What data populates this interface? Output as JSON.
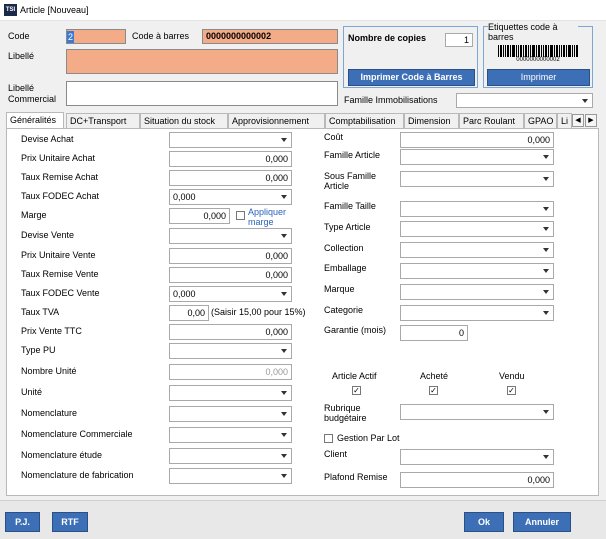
{
  "window": {
    "icon_text": "TSI",
    "title": "Article [Nouveau]"
  },
  "header": {
    "code_label": "Code",
    "code_value": "2",
    "barcode_label": "Code à barres",
    "barcode_value": "0000000000002",
    "libelle_label": "Libellé",
    "libelle_value": "",
    "libelle_commercial_label": "Libellé Commercial",
    "libelle_commercial_value": ""
  },
  "copies": {
    "label": "Nombre de copies",
    "value": "1",
    "print_button": "Imprimer Code à Barres"
  },
  "etiquettes": {
    "label": "Etiquettes code à barres",
    "barcode_digits": "0000000000002",
    "print_button": "Imprimer"
  },
  "famille_immobilisations": {
    "label": "Famille Immobilisations",
    "value": ""
  },
  "tabs": [
    "Généralités",
    "DC+Transport",
    "Situation du stock",
    "Approvisionnement",
    "Comptabilisation",
    "Dimension",
    "Parc Roulant",
    "GPAO",
    "Li"
  ],
  "left_fields": [
    {
      "label": "Devise Achat",
      "value": "",
      "type": "dropdown"
    },
    {
      "label": "Prix Unitaire Achat",
      "value": "0,000",
      "type": "number"
    },
    {
      "label": "Taux Remise Achat",
      "value": "0,000",
      "type": "number"
    },
    {
      "label": "Taux FODEC Achat",
      "value": "0,000",
      "type": "dropdown"
    },
    {
      "label": "Marge",
      "value": "0,000",
      "type": "number"
    },
    {
      "label": "Devise Vente",
      "value": "",
      "type": "dropdown"
    },
    {
      "label": "Prix Unitaire Vente",
      "value": "0,000",
      "type": "number"
    },
    {
      "label": "Taux Remise Vente",
      "value": "0,000",
      "type": "number"
    },
    {
      "label": "Taux FODEC Vente",
      "value": "0,000",
      "type": "dropdown"
    },
    {
      "label": "Taux TVA",
      "value": "0,00",
      "type": "number"
    },
    {
      "label": "Prix Vente TTC",
      "value": "0,000",
      "type": "number"
    },
    {
      "label": "Type PU",
      "value": "",
      "type": "dropdown"
    },
    {
      "label": "Nombre Unité",
      "value": "0,000",
      "type": "number"
    },
    {
      "label": "Unité",
      "value": "",
      "type": "dropdown"
    },
    {
      "label": "Nomenclature",
      "value": "",
      "type": "dropdown"
    },
    {
      "label": "Nomenclature Commerciale",
      "value": "",
      "type": "dropdown"
    },
    {
      "label": "Nomenclature étude",
      "value": "",
      "type": "dropdown"
    },
    {
      "label": "Nomenclature de fabrication",
      "value": "",
      "type": "dropdown"
    }
  ],
  "appliquer_marge": "Appliquer marge",
  "tva_hint": "(Saisir 15,00 pour 15%)",
  "right_fields": [
    {
      "label": "Coût",
      "value": "0,000",
      "type": "number"
    },
    {
      "label": "Famille Article",
      "value": "",
      "type": "dropdown"
    },
    {
      "label": "Sous Famille Article",
      "value": "",
      "type": "dropdown"
    },
    {
      "label": "Famille Taille",
      "value": "",
      "type": "dropdown"
    },
    {
      "label": "Type Article",
      "value": "",
      "type": "dropdown"
    },
    {
      "label": "Collection",
      "value": "",
      "type": "dropdown"
    },
    {
      "label": "Emballage",
      "value": "",
      "type": "dropdown"
    },
    {
      "label": "Marque",
      "value": "",
      "type": "dropdown"
    },
    {
      "label": "Categorie",
      "value": "",
      "type": "dropdown"
    },
    {
      "label": "Garantie (mois)",
      "value": "0",
      "type": "number"
    }
  ],
  "flags": {
    "article_actif": "Article Actif",
    "achete": "Acheté",
    "vendu": "Vendu"
  },
  "rubrique": {
    "label": "Rubrique budgétaire",
    "value": ""
  },
  "gestion_par_lot": "Gestion Par Lot",
  "client": {
    "label": "Client",
    "value": ""
  },
  "plafond_remise": {
    "label": "Plafond Remise",
    "value": "0,000"
  },
  "buttons": {
    "pj": "P.J.",
    "rtf": "RTF",
    "ok": "Ok",
    "annuler": "Annuler"
  }
}
